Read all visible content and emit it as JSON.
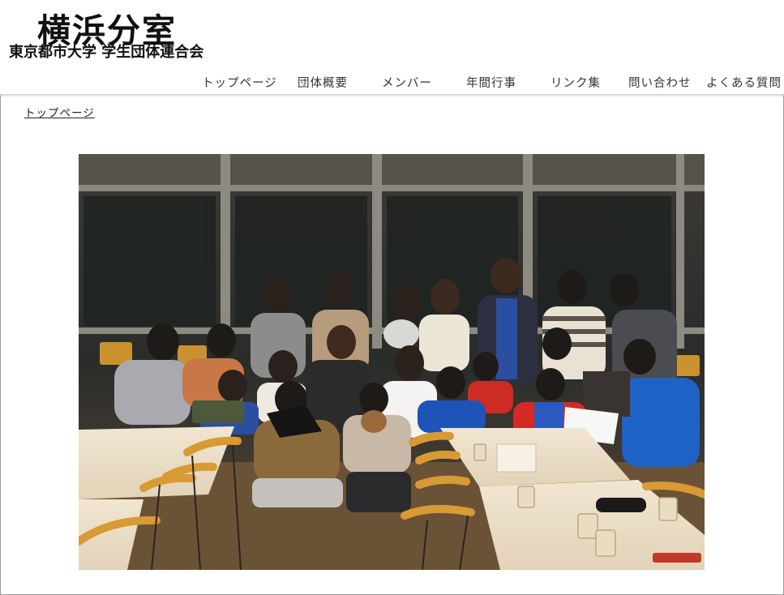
{
  "header": {
    "logo_title": "横浜分室",
    "logo_subtitle": "東京都市大学 学生団体連合会"
  },
  "nav": {
    "items": [
      {
        "label": "トップページ"
      },
      {
        "label": "団体概要"
      },
      {
        "label": "メンバー"
      },
      {
        "label": "年間行事"
      },
      {
        "label": "リンク集"
      },
      {
        "label": "問い合わせ"
      },
      {
        "label": "よくある質問"
      }
    ]
  },
  "breadcrumb": {
    "current": "トップページ"
  },
  "photo": {
    "description_icon": "group-photo-icon"
  }
}
